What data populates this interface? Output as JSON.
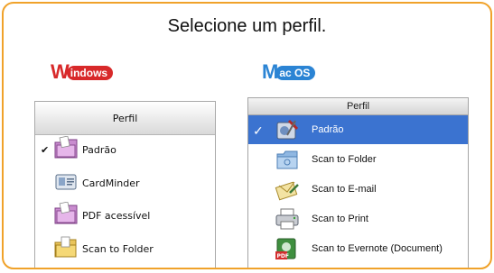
{
  "title": "Selecione um perfil.",
  "windows": {
    "badge_initial": "W",
    "badge_rest": "indows",
    "header": "Perfil",
    "items": [
      {
        "label": "Padrão",
        "selected": true,
        "icon": "folder-profile-icon"
      },
      {
        "label": "CardMinder",
        "selected": false,
        "icon": "card-icon"
      },
      {
        "label": "PDF acessível",
        "selected": false,
        "icon": "folder-profile-icon"
      },
      {
        "label": "Scan to Folder",
        "selected": false,
        "icon": "yellow-folder-icon"
      }
    ],
    "check_mark": "✔"
  },
  "mac": {
    "badge_initial": "M",
    "badge_rest": "ac OS",
    "header": "Perfil",
    "items": [
      {
        "label": "Padrão",
        "selected": true,
        "icon": "tools-icon"
      },
      {
        "label": "Scan to Folder",
        "selected": false,
        "icon": "blue-folder-icon"
      },
      {
        "label": "Scan to E-mail",
        "selected": false,
        "icon": "envelope-icon"
      },
      {
        "label": "Scan to Print",
        "selected": false,
        "icon": "printer-icon"
      },
      {
        "label": "Scan to Evernote (Document)",
        "selected": false,
        "icon": "evernote-pdf-icon"
      }
    ],
    "check_mark": "✓"
  },
  "colors": {
    "frame": "#f0a22a",
    "windows_badge": "#d8292a",
    "mac_badge": "#2b84d4",
    "mac_selection": "#3b73d0"
  }
}
